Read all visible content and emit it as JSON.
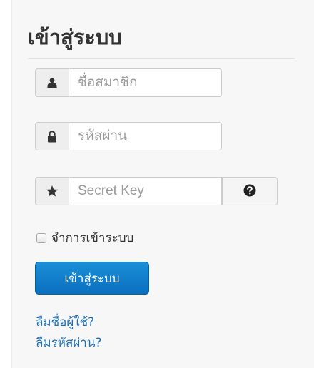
{
  "login": {
    "title": "เข้าสู่ระบบ",
    "username": {
      "placeholder": "ชื่อสมาชิก",
      "icon": "user-icon"
    },
    "password": {
      "placeholder": "รหัสผ่าน",
      "icon": "lock-icon"
    },
    "secret_key": {
      "placeholder": "Secret Key",
      "icon": "star-icon",
      "help_icon": "question-circle-icon"
    },
    "remember_label": "จำการเข้าระบบ",
    "submit_label": "เข้าสู่ระบบ",
    "forgot_username": "ลืมชื่อผู้ใช้?",
    "forgot_password": "ลืมรหัสผ่าน?"
  },
  "colors": {
    "panel_bg": "#f7f7f7",
    "primary": "#0e7fce",
    "link": "#1a6fbd"
  }
}
